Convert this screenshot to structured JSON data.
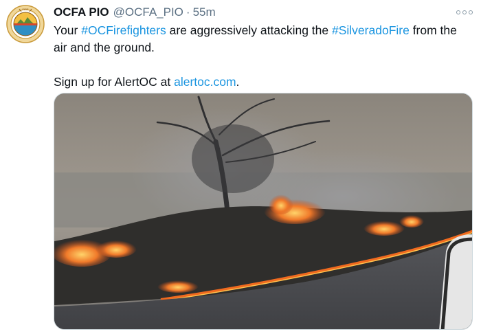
{
  "tweet": {
    "author_name": "OCFA PIO",
    "author_handle": "@OCFA_PIO",
    "separator": "·",
    "time_ago": "55m",
    "line1": {
      "pre": "Your ",
      "hashtag1": "#OCFirefighters",
      "mid": " are aggressively attacking the ",
      "hashtag2": "#SilveradoFire",
      "post": " from the air and the ground."
    },
    "line2": {
      "pre": "Sign up for AlertOC at ",
      "link": "alertoc.com",
      "post": "."
    },
    "media": {
      "kind": "video",
      "subject": "Silverado Fire burning brush along a roadside"
    }
  },
  "icons": {
    "avatar": "ocfa-badge-icon",
    "more": "more-options-icon"
  },
  "colors": {
    "link": "#1b95e0",
    "secondary": "#5b7083",
    "text": "#0f1419"
  }
}
